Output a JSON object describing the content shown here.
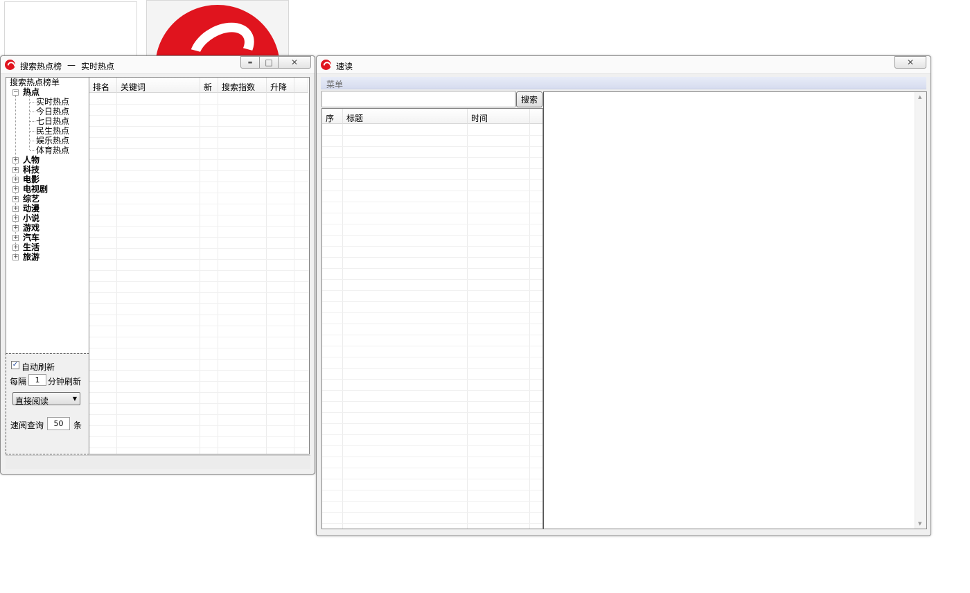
{
  "left_window": {
    "title": "搜索热点榜",
    "title_sep": "—",
    "subtitle": "实时热点",
    "controls": {
      "minimize": "▬",
      "maximize": "□",
      "close": "✕"
    },
    "tree": {
      "root": "搜索热点榜单",
      "expanded": {
        "label": "热点",
        "toggle": "−",
        "children": [
          "实时热点",
          "今日热点",
          "七日热点",
          "民生热点",
          "娱乐热点",
          "体育热点"
        ]
      },
      "collapsed": [
        "人物",
        "科技",
        "电影",
        "电视剧",
        "综艺",
        "动漫",
        "小说",
        "游戏",
        "汽车",
        "生活",
        "旅游"
      ],
      "collapsed_toggle": "+"
    },
    "columns": [
      "排名",
      "关键词",
      "新",
      "搜索指数",
      "升降"
    ],
    "options": {
      "auto_refresh_label": "自动刷新",
      "auto_refresh_checked": true,
      "check_mark": "✓",
      "interval_prefix": "每隔",
      "interval_value": "1",
      "interval_suffix": "分钟刷新",
      "mode_selected": "直接阅读",
      "dropdown_arrow": "▼",
      "query_label": "速阅查询",
      "query_value": "50",
      "query_unit": "条"
    }
  },
  "right_window": {
    "title": "速读",
    "close": "✕",
    "menu_label": "菜单",
    "search_value": "",
    "search_button": "搜索",
    "columns": [
      "序",
      "标题",
      "时间"
    ],
    "scroll_up": "▲",
    "scroll_down": "▼"
  },
  "colors": {
    "brand": "#e0141e",
    "menu_bar": "#dde3f3"
  }
}
